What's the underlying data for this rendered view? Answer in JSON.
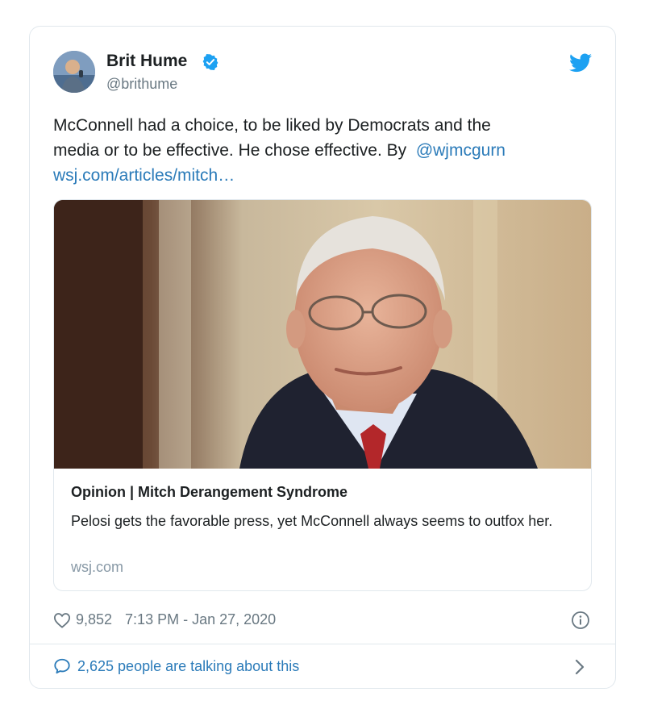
{
  "author": {
    "name": "Brit Hume",
    "handle": "@brithume",
    "verified": true
  },
  "tweet": {
    "text_line1": "McConnell had a choice, to be liked by Democrats and the",
    "text_line2": "media or to be effective. He chose effective. By",
    "mention": "@wjmcgurn",
    "link": "wsj.com/articles/mitch…"
  },
  "link_card": {
    "title": "Opinion | Mitch Derangement Syndrome",
    "description": "Pelosi gets the favorable press, yet McConnell always seems to outfox her.",
    "domain": "wsj.com"
  },
  "meta": {
    "likes": "9,852",
    "timestamp": "7:13 PM - Jan 27, 2020"
  },
  "footer": {
    "talking": "2,625 people are talking about this"
  },
  "icons": {
    "bird": "twitter-bird-icon",
    "verified": "verified-badge-icon",
    "heart": "heart-icon",
    "info": "info-icon",
    "bubble": "speech-bubble-icon",
    "chevron": "chevron-right-icon"
  },
  "colors": {
    "brand_blue": "#1da1f2",
    "link_blue": "#2b7bb9",
    "muted": "#697882",
    "border": "#e1e8ed"
  }
}
